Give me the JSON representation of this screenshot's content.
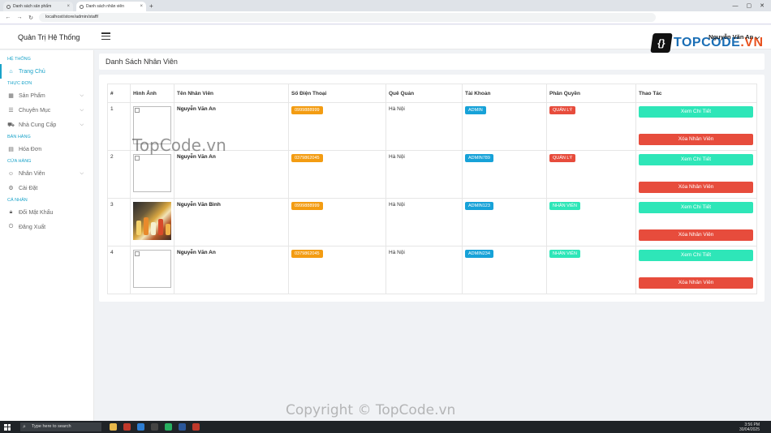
{
  "browser": {
    "tabs": [
      {
        "title": "Danh sách sản phẩm",
        "active": false
      },
      {
        "title": "Danh sách nhân viên",
        "active": true
      }
    ],
    "url": "localhost/store/admin/staff/"
  },
  "app": {
    "brand": "Quản Trị Hệ Thống",
    "user": "Nguyễn Văn An",
    "logo_main": "TOPCODE",
    "logo_tld": ".VN"
  },
  "sidebar": {
    "sections": [
      {
        "title": "HỆ THỐNG",
        "items": [
          {
            "label": "Trang Chủ",
            "icon": "home-icon",
            "active": true
          }
        ]
      },
      {
        "title": "THỰC ĐƠN",
        "items": [
          {
            "label": "Sản Phẩm",
            "icon": "grid-icon",
            "chevron": true
          },
          {
            "label": "Chuyên Mục",
            "icon": "list-icon",
            "chevron": true
          },
          {
            "label": "Nhà Cung Cấp",
            "icon": "truck-icon",
            "chevron": true
          }
        ]
      },
      {
        "title": "BÁN HÀNG",
        "items": [
          {
            "label": "Hóa Đơn",
            "icon": "invoice-icon"
          }
        ]
      },
      {
        "title": "CỬA HÀNG",
        "items": [
          {
            "label": "Nhân Viên",
            "icon": "user-icon",
            "chevron": true
          },
          {
            "label": "Cài Đặt",
            "icon": "gear-icon"
          }
        ]
      },
      {
        "title": "CÁ NHÂN",
        "items": [
          {
            "label": "Đổi Mật Khẩu",
            "icon": "lock-icon"
          },
          {
            "label": "Đăng Xuất",
            "icon": "power-icon"
          }
        ]
      }
    ]
  },
  "page": {
    "title": "Danh Sách Nhân Viên"
  },
  "table": {
    "headers": [
      "#",
      "Hình Ảnh",
      "Tên Nhân Viên",
      "Số Điện Thoại",
      "Quê Quán",
      "Tài Khoản",
      "Phân Quyền",
      "Thao Tác"
    ],
    "rows": [
      {
        "index": "1",
        "image": "broken",
        "name": "Nguyễn Văn An",
        "phone": "0999888999",
        "hometown": "Hà Nội",
        "account": "ADMIN",
        "role": "QUẢN LÝ",
        "role_type": "manager"
      },
      {
        "index": "2",
        "image": "broken",
        "name": "Nguyễn Văn An",
        "phone": "0379862045",
        "hometown": "Hà Nội",
        "account": "ADMIN789",
        "role": "QUẢN LÝ",
        "role_type": "manager"
      },
      {
        "index": "3",
        "image": "photo",
        "name": "Nguyễn Văn Bình",
        "phone": "0999888999",
        "hometown": "Hà Nội",
        "account": "ADMIN123",
        "role": "NHÂN VIÊN",
        "role_type": "staff"
      },
      {
        "index": "4",
        "image": "broken",
        "name": "Nguyễn Văn An",
        "phone": "0379862045",
        "hometown": "Hà Nội",
        "account": "ADMIN234",
        "role": "NHÂN VIÊN",
        "role_type": "staff"
      }
    ],
    "view_label": "Xem Chi Tiết",
    "delete_label": "Xóa Nhân Viên"
  },
  "watermarks": {
    "top": "TopCode.vn",
    "bottom": "Copyright © TopCode.vn"
  },
  "taskbar": {
    "search_placeholder": "Type here to search",
    "time": "3:56 PM",
    "date": "30/04/2025"
  },
  "colors": {
    "accent": "#1aa3c9",
    "phone_badge": "#f39c12",
    "account_badge": "#17a2d8",
    "manager_badge": "#e74c3c",
    "staff_badge": "#2ee6b8",
    "view_button": "#2ee6b8",
    "delete_button": "#e74c3c"
  }
}
